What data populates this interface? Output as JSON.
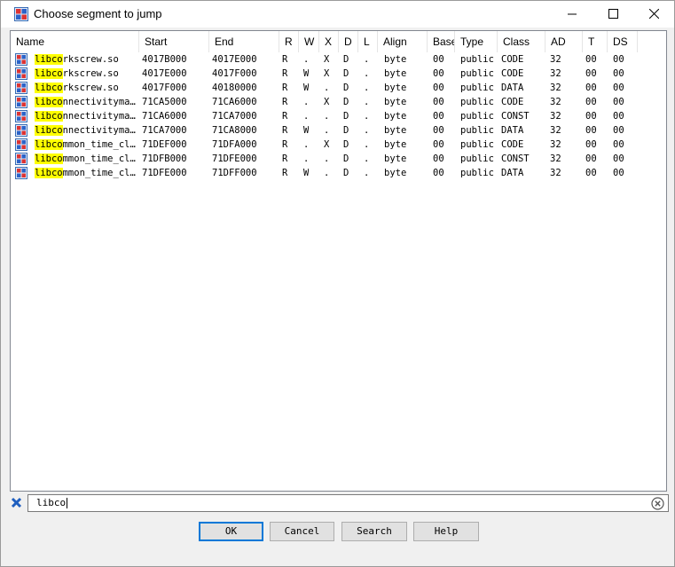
{
  "window": {
    "title": "Choose segment to jump"
  },
  "columns": [
    "Name",
    "Start",
    "End",
    "R",
    "W",
    "X",
    "D",
    "L",
    "Align",
    "Base",
    "Type",
    "Class",
    "AD",
    "T",
    "DS"
  ],
  "filter": {
    "value": "libco"
  },
  "rows": [
    {
      "name_hl": "libco",
      "name_rest": "rkscrew.so",
      "start": "4017B000",
      "end": "4017E000",
      "r": "R",
      "w": ".",
      "x": "X",
      "d": "D",
      "l": ".",
      "align": "byte",
      "base": "00",
      "type": "public",
      "class": "CODE",
      "ad": "32",
      "t": "00",
      "ds": "00"
    },
    {
      "name_hl": "libco",
      "name_rest": "rkscrew.so",
      "start": "4017E000",
      "end": "4017F000",
      "r": "R",
      "w": "W",
      "x": "X",
      "d": "D",
      "l": ".",
      "align": "byte",
      "base": "00",
      "type": "public",
      "class": "CODE",
      "ad": "32",
      "t": "00",
      "ds": "00"
    },
    {
      "name_hl": "libco",
      "name_rest": "rkscrew.so",
      "start": "4017F000",
      "end": "40180000",
      "r": "R",
      "w": "W",
      "x": ".",
      "d": "D",
      "l": ".",
      "align": "byte",
      "base": "00",
      "type": "public",
      "class": "DATA",
      "ad": "32",
      "t": "00",
      "ds": "00"
    },
    {
      "name_hl": "libco",
      "name_rest": "nnectivityma…",
      "start": "71CA5000",
      "end": "71CA6000",
      "r": "R",
      "w": ".",
      "x": "X",
      "d": "D",
      "l": ".",
      "align": "byte",
      "base": "00",
      "type": "public",
      "class": "CODE",
      "ad": "32",
      "t": "00",
      "ds": "00"
    },
    {
      "name_hl": "libco",
      "name_rest": "nnectivityma…",
      "start": "71CA6000",
      "end": "71CA7000",
      "r": "R",
      "w": ".",
      "x": ".",
      "d": "D",
      "l": ".",
      "align": "byte",
      "base": "00",
      "type": "public",
      "class": "CONST",
      "ad": "32",
      "t": "00",
      "ds": "00"
    },
    {
      "name_hl": "libco",
      "name_rest": "nnectivityma…",
      "start": "71CA7000",
      "end": "71CA8000",
      "r": "R",
      "w": "W",
      "x": ".",
      "d": "D",
      "l": ".",
      "align": "byte",
      "base": "00",
      "type": "public",
      "class": "DATA",
      "ad": "32",
      "t": "00",
      "ds": "00"
    },
    {
      "name_hl": "libco",
      "name_rest": "mmon_time_cl…",
      "start": "71DEF000",
      "end": "71DFA000",
      "r": "R",
      "w": ".",
      "x": "X",
      "d": "D",
      "l": ".",
      "align": "byte",
      "base": "00",
      "type": "public",
      "class": "CODE",
      "ad": "32",
      "t": "00",
      "ds": "00"
    },
    {
      "name_hl": "libco",
      "name_rest": "mmon_time_cl…",
      "start": "71DFB000",
      "end": "71DFE000",
      "r": "R",
      "w": ".",
      "x": ".",
      "d": "D",
      "l": ".",
      "align": "byte",
      "base": "00",
      "type": "public",
      "class": "CONST",
      "ad": "32",
      "t": "00",
      "ds": "00"
    },
    {
      "name_hl": "libco",
      "name_rest": "mmon_time_cl…",
      "start": "71DFE000",
      "end": "71DFF000",
      "r": "R",
      "w": "W",
      "x": ".",
      "d": "D",
      "l": ".",
      "align": "byte",
      "base": "00",
      "type": "public",
      "class": "DATA",
      "ad": "32",
      "t": "00",
      "ds": "00"
    }
  ],
  "buttons": {
    "ok": "OK",
    "cancel": "Cancel",
    "search": "Search",
    "help": "Help"
  },
  "icons": {
    "app": "ida-segment-icon",
    "row": "segment-icon",
    "minimize": "minimize-icon",
    "maximize": "maximize-icon",
    "close": "close-icon",
    "filter_clear": "x-icon",
    "input_clear": "circle-x-icon"
  },
  "colors": {
    "highlight": "#ffff00",
    "default_button_border": "#0078d7",
    "filter_x": "#1f5fbf"
  }
}
